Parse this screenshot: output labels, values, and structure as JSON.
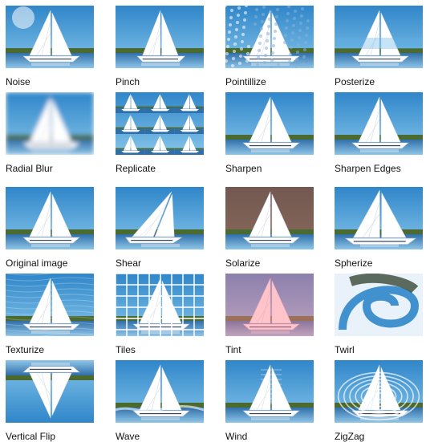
{
  "filters": [
    {
      "id": "noise",
      "label": "Noise",
      "effect": "noise",
      "tint": "#ffffff"
    },
    {
      "id": "pinch",
      "label": "Pinch",
      "effect": "pinch",
      "tint": "#ffffff"
    },
    {
      "id": "pointillize",
      "label": "Pointillize",
      "effect": "pointillize",
      "tint": "#ffffff"
    },
    {
      "id": "posterize",
      "label": "Posterize",
      "effect": "posterize",
      "tint": "#ffffff"
    },
    {
      "id": "radial-blur",
      "label": "Radial Blur",
      "effect": "blur",
      "tint": "#ffffff"
    },
    {
      "id": "replicate",
      "label": "Replicate",
      "effect": "replicate",
      "tint": "#ffffff"
    },
    {
      "id": "sharpen",
      "label": "Sharpen",
      "effect": "sharpen",
      "tint": "#ffffff"
    },
    {
      "id": "sharpen-edges",
      "label": "Sharpen Edges",
      "effect": "sharpen",
      "tint": "#ffffff"
    },
    {
      "id": "original-image",
      "label": "Original image",
      "effect": "original",
      "tint": "#ffffff"
    },
    {
      "id": "shear",
      "label": "Shear",
      "effect": "shear",
      "tint": "#ffffff"
    },
    {
      "id": "solarize",
      "label": "Solarize",
      "effect": "solarize",
      "tint": "#ffffff"
    },
    {
      "id": "spherize",
      "label": "Spherize",
      "effect": "spherize",
      "tint": "#ffffff"
    },
    {
      "id": "texturize",
      "label": "Texturize",
      "effect": "texturize",
      "tint": "#ffffff"
    },
    {
      "id": "tiles",
      "label": "Tiles",
      "effect": "tiles",
      "tint": "#ffffff"
    },
    {
      "id": "tint",
      "label": "Tint",
      "effect": "tint",
      "tint": "#ff7a8a"
    },
    {
      "id": "twirl",
      "label": "Twirl",
      "effect": "twirl",
      "tint": "#ffffff"
    },
    {
      "id": "vertical-flip",
      "label": "Vertical Flip",
      "effect": "flip",
      "tint": "#ffffff"
    },
    {
      "id": "wave",
      "label": "Wave",
      "effect": "wave",
      "tint": "#ffffff"
    },
    {
      "id": "wind",
      "label": "Wind",
      "effect": "wind",
      "tint": "#ffffff"
    },
    {
      "id": "zigzag",
      "label": "ZigZag",
      "effect": "zigzag",
      "tint": "#ffffff"
    }
  ],
  "colors": {
    "sky_top": "#2f86c9",
    "sky_bottom": "#86c5ea",
    "land": "#4b6a2f",
    "water_top": "#2f6fa9",
    "water_bottom": "#8fc5e8",
    "sail": "#ffffff",
    "sail_shadow": "#d9dee6",
    "hull": "#ffffff"
  }
}
